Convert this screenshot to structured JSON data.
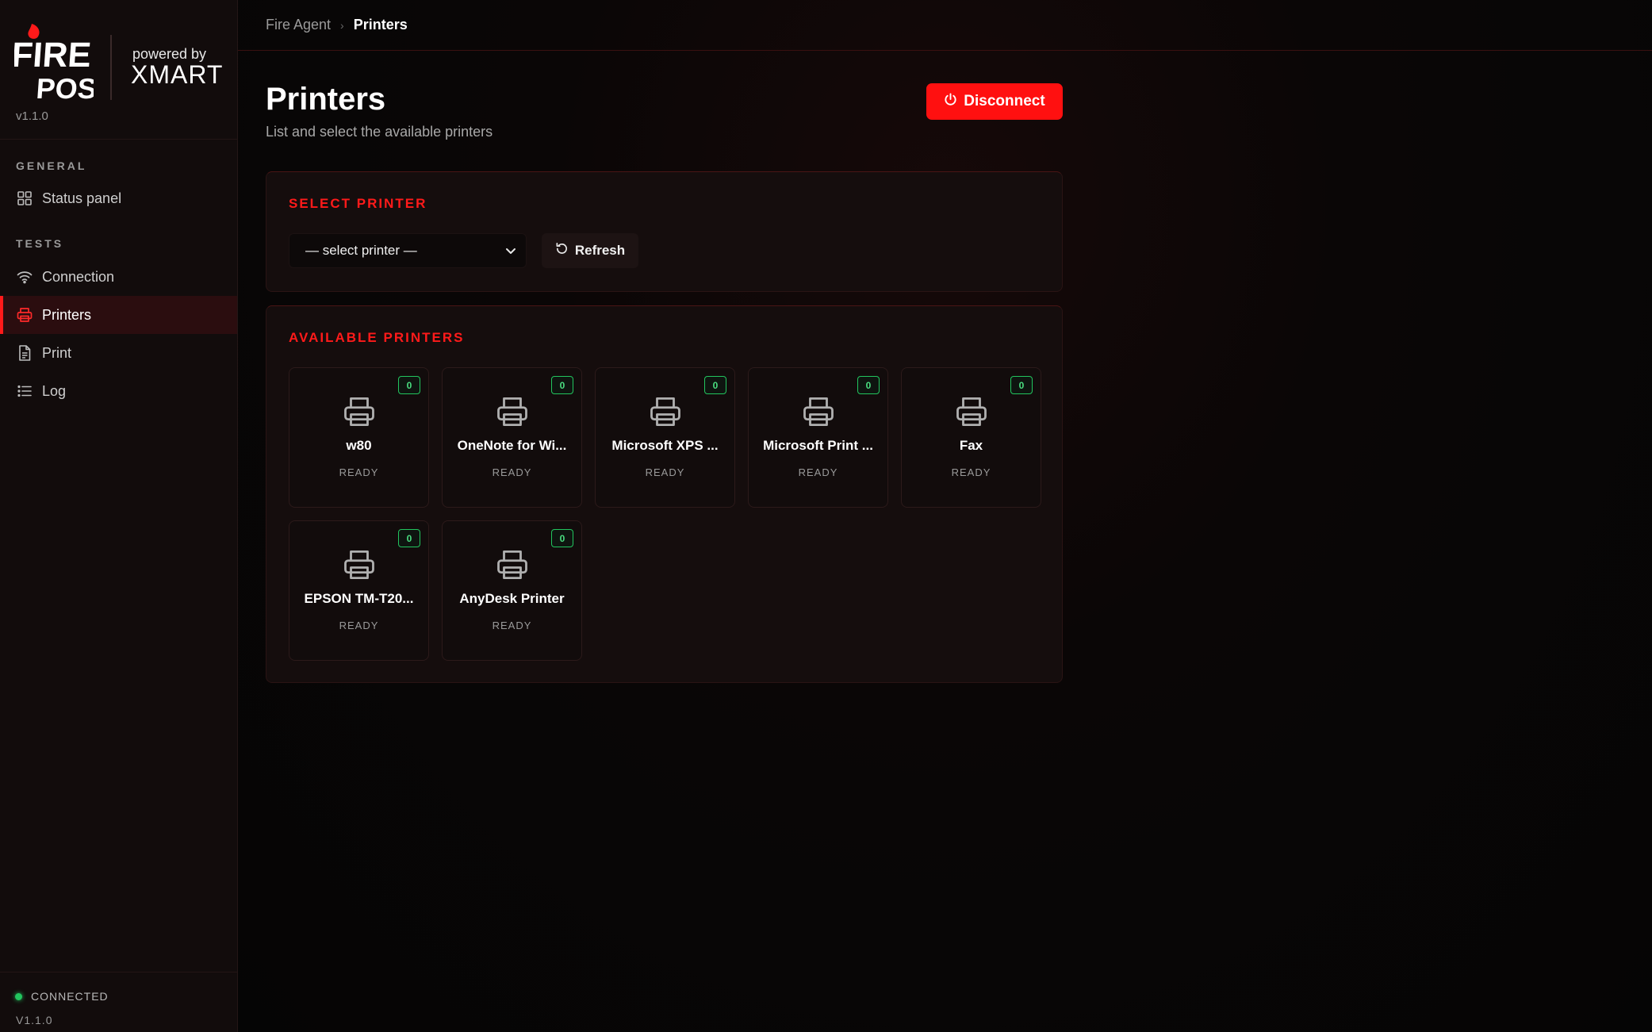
{
  "brand": {
    "logo_text_top": "FIRE",
    "logo_text_bottom": "POS",
    "powered_by": "powered by",
    "partner": "XMART",
    "version": "v1.1.0"
  },
  "sidebar": {
    "sections": [
      {
        "label": "GENERAL"
      },
      {
        "label": "TESTS"
      }
    ],
    "items": [
      {
        "label": "Status panel",
        "icon": "grid-icon"
      },
      {
        "label": "Connection",
        "icon": "wifi-icon"
      },
      {
        "label": "Printers",
        "icon": "printer-icon",
        "active": true
      },
      {
        "label": "Print",
        "icon": "document-icon"
      },
      {
        "label": "Log",
        "icon": "list-icon"
      }
    ],
    "footer": {
      "status": "CONNECTED",
      "status_color": "#22c55e",
      "version": "V1.1.0"
    }
  },
  "header": {
    "breadcrumb": {
      "root": "Fire Agent",
      "separator": "›",
      "current": "Printers"
    }
  },
  "page": {
    "title": "Printers",
    "subtitle": "List and select the available printers",
    "disconnect_label": "Disconnect"
  },
  "select_card": {
    "title": "SELECT PRINTER",
    "select_value": "— select printer —",
    "refresh_label": "Refresh"
  },
  "available_card": {
    "title": "AVAILABLE PRINTERS",
    "printers": [
      {
        "name": "w80",
        "status": "READY",
        "jobs": "0"
      },
      {
        "name": "OneNote for Wi...",
        "status": "READY",
        "jobs": "0"
      },
      {
        "name": "Microsoft XPS ...",
        "status": "READY",
        "jobs": "0"
      },
      {
        "name": "Microsoft Print ...",
        "status": "READY",
        "jobs": "0"
      },
      {
        "name": "Fax",
        "status": "READY",
        "jobs": "0"
      },
      {
        "name": "EPSON TM-T20...",
        "status": "READY",
        "jobs": "0"
      },
      {
        "name": "AnyDesk Printer",
        "status": "READY",
        "jobs": "0"
      }
    ]
  },
  "colors": {
    "accent": "#ff1010",
    "ready_badge": "#22c55e"
  }
}
